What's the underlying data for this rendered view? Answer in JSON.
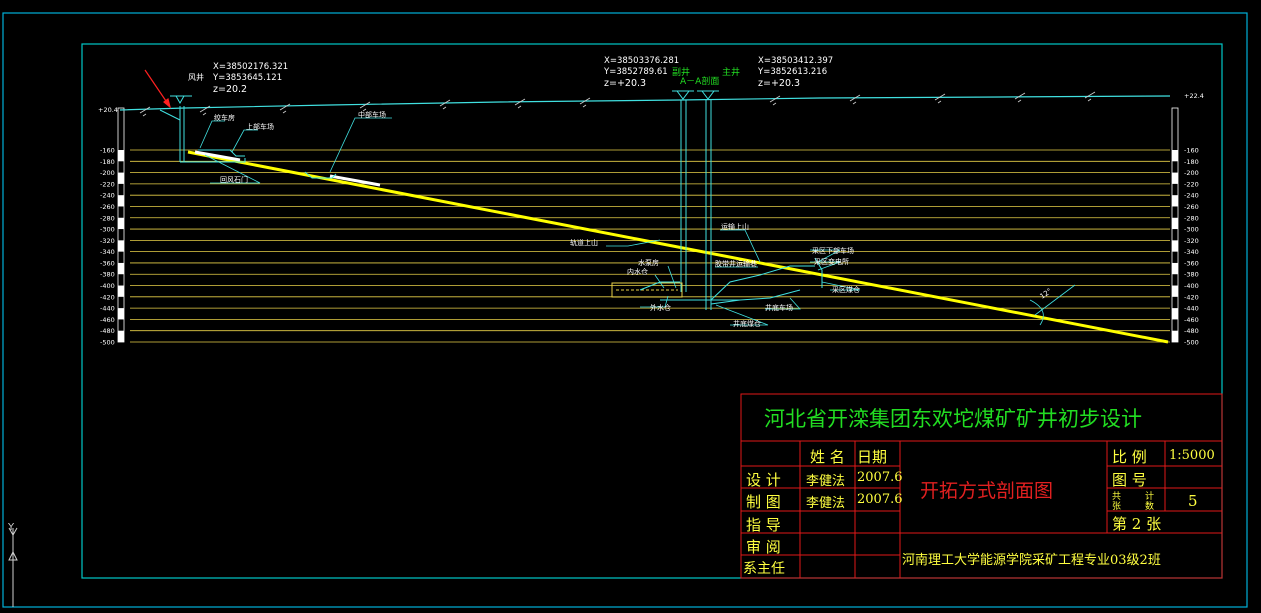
{
  "colors": {
    "background": "#000000",
    "frame": "#00c8c8",
    "inner_frame": "#00b8d8",
    "surface": "#40e0e0",
    "level_line": "#e8d048",
    "coal_seam": "#ffff00",
    "shaft": "#40e0e0",
    "label": "#ffffff",
    "title_green": "#22dd22",
    "title_red": "#e02020",
    "table_line": "#e01818",
    "table_text": "#ffff40",
    "arrow": "#ff2020"
  },
  "coords": {
    "left_x": "X=38502176.321",
    "left_y": "Y=3853645.121",
    "left_z": "z=20.2",
    "mid_x": "X=38503376.281",
    "mid_y": "Y=3852789.61",
    "mid_z": "z=+20.3",
    "right_x": "X=38503412.397",
    "right_y": "Y=3852613.216",
    "right_z": "z=+20.3"
  },
  "shafts": {
    "air": "风井",
    "aux": "副井",
    "main": "主井",
    "section": "A－A剖面"
  },
  "surface_elev": {
    "left": "+20.4",
    "right": "+22.4"
  },
  "levels": [
    "-160",
    "-180",
    "-200",
    "-220",
    "-240",
    "-260",
    "-280",
    "-300",
    "-320",
    "-340",
    "-360",
    "-380",
    "-400",
    "-420",
    "-440",
    "-460",
    "-480",
    "-500"
  ],
  "labels": {
    "winch_room": "绞车房",
    "upper_car_yard": "上部车场",
    "middle_car_yard": "中部车场",
    "return_crosscut": "回风石门",
    "transport_up": "运输上山",
    "track_up": "轨道上山",
    "pump_room": "水泵房",
    "inner_sump": "内水仓",
    "outer_sump": "外水仓",
    "bottom_station": "井底车场",
    "bottom_coal_bin": "井底煤仓",
    "district_lower_yard": "采区下部车场",
    "district_substation": "采区变电所",
    "district_coal_bin": "采区煤仓",
    "main_coal_bin": "井底煤仓",
    "track_crosscut": "胶带井运输巷"
  },
  "dip_angle": "12°",
  "title_block": {
    "project_title": "河北省开滦集团东欢坨煤矿矿井初步设计",
    "drawing_title": "开拓方式剖面图",
    "col_name": "姓 名",
    "col_date": "日期",
    "rows": [
      {
        "role": "设 计",
        "name": "李健法",
        "date": "2007.6"
      },
      {
        "role": "制 图",
        "name": "李健法",
        "date": "2007.6"
      },
      {
        "role": "指 导",
        "name": "",
        "date": ""
      },
      {
        "role": "审 阅",
        "name": "",
        "date": ""
      },
      {
        "role": "系主任",
        "name": "",
        "date": ""
      }
    ],
    "scale_label": "比 例",
    "scale_value": "1:5000",
    "drawing_no_label": "图 号",
    "total_label_1": "共",
    "total_label_2": "计",
    "total_label_3": "张",
    "total_label_4": "数",
    "total_value": "5",
    "sheet_label": "第 2 张",
    "school": "河南理工大学能源学院采矿工程专业03级2班"
  },
  "ucs_label": "Y"
}
